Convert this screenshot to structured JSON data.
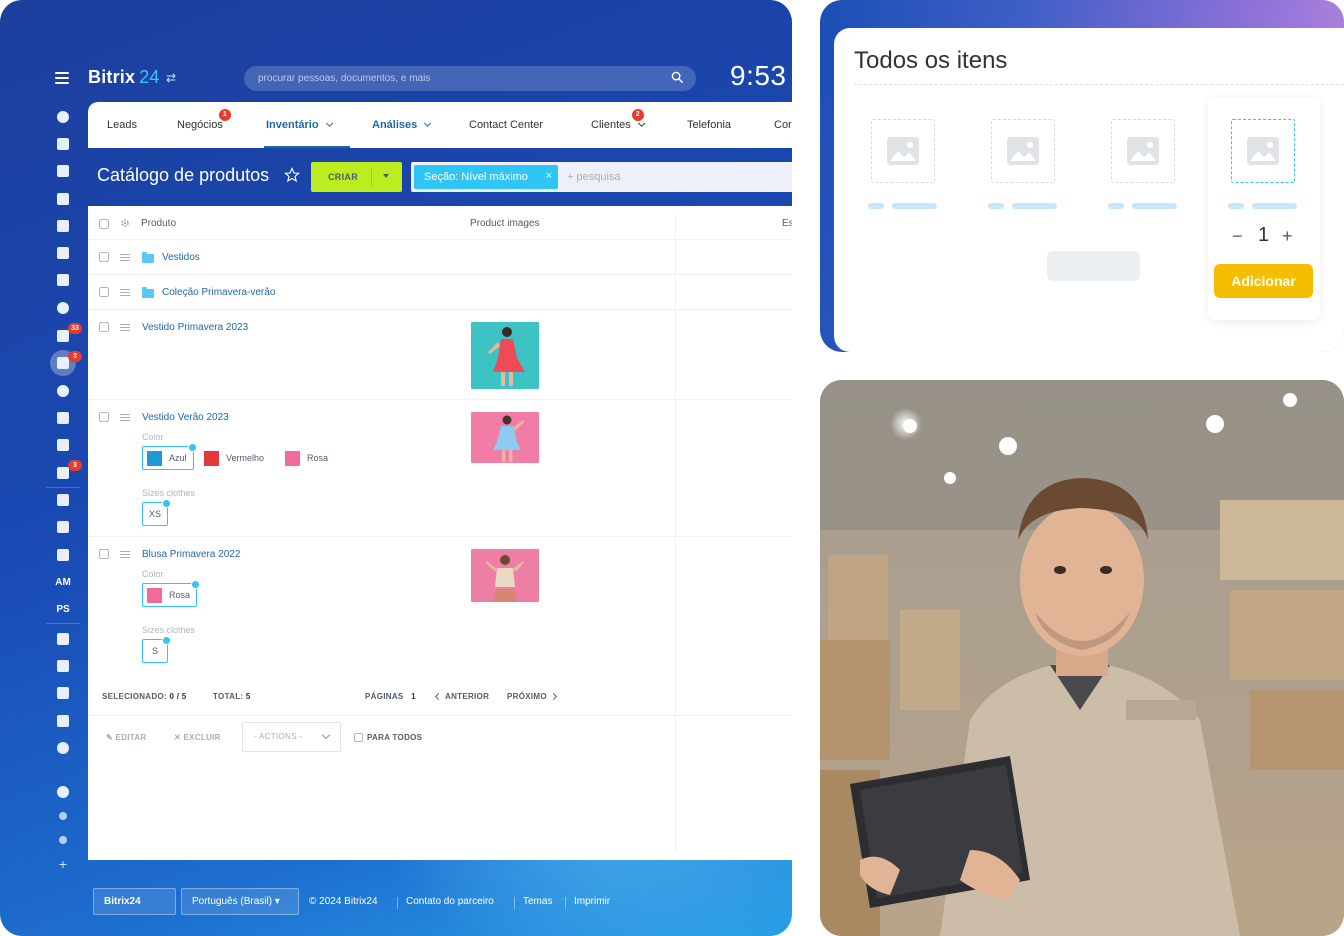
{
  "app": {
    "brand_name": "Bitrix",
    "brand_num": "24",
    "search_placeholder": "procurar pessoas, documentos, e mais",
    "clock": "9:53"
  },
  "tabs": [
    {
      "label": "Leads"
    },
    {
      "label": "Negócios",
      "badge": "1"
    },
    {
      "label": "Inventário"
    },
    {
      "label": "Análises"
    },
    {
      "label": "Contact Center"
    },
    {
      "label": "Clientes",
      "badge": "2"
    },
    {
      "label": "Telefonia"
    },
    {
      "label": "Cor"
    }
  ],
  "sidebar": {
    "badges": [
      "33",
      "3",
      "3"
    ],
    "text_items": [
      "AM",
      "PS"
    ]
  },
  "catalog": {
    "title": "Catálogo de produtos",
    "create_label": "CRIAR",
    "filter_chip": "Seção: Nível máximo",
    "filter_add": "+ pesquisa",
    "columns": [
      "Produto",
      "Product images",
      "Es"
    ],
    "rows": [
      {
        "name": "Vestidos"
      },
      {
        "name": "Coleção Primavera-verão"
      },
      {
        "name": "Vestido Primavera 2023"
      },
      {
        "name": "Vestido Verão 2023",
        "color_label": "Color",
        "colors": [
          "Azul",
          "Vermelho",
          "Rosa"
        ],
        "sizes_label": "Sizes clothes",
        "sizes": [
          "XS"
        ]
      },
      {
        "name": "Blusa Primavera 2022",
        "color_label": "Color",
        "colors": [
          "Rosa"
        ],
        "sizes_label": "Sizes clothes",
        "sizes": [
          "S"
        ]
      }
    ],
    "stats": {
      "selected_label": "SELECIONADO:",
      "selected_value": "0 / 5",
      "total_label": "TOTAL:",
      "total_value": "5",
      "pages_label": "PÁGINAS",
      "pages_value": "1",
      "prev": "ANTERIOR",
      "next": "PRÓXIMO"
    },
    "actions": {
      "edit": "EDITAR",
      "delete": "EXCLUIR",
      "select": "- ACTIONS -",
      "all": "PARA TODOS"
    }
  },
  "footer": {
    "logo": "Bitrix24",
    "language": "Português (Brasil)",
    "copyright": "© 2024 Bitrix24",
    "links": [
      "Contato do parceiro",
      "Temas",
      "Imprimir"
    ]
  },
  "items_panel": {
    "title": "Todos os itens",
    "qty": "1",
    "minus": "−",
    "plus": "+",
    "add_label": "Adicionar"
  },
  "colors": {
    "accent": "#2067b0",
    "create_green": "#bbed21",
    "chip_blue": "#2fc6f6",
    "badge_red": "#e83a2f",
    "add_yellow": "#f5be00",
    "swatch_blue": "#1f98d6",
    "swatch_red": "#e03a3a",
    "swatch_pink": "#f06a9b"
  }
}
